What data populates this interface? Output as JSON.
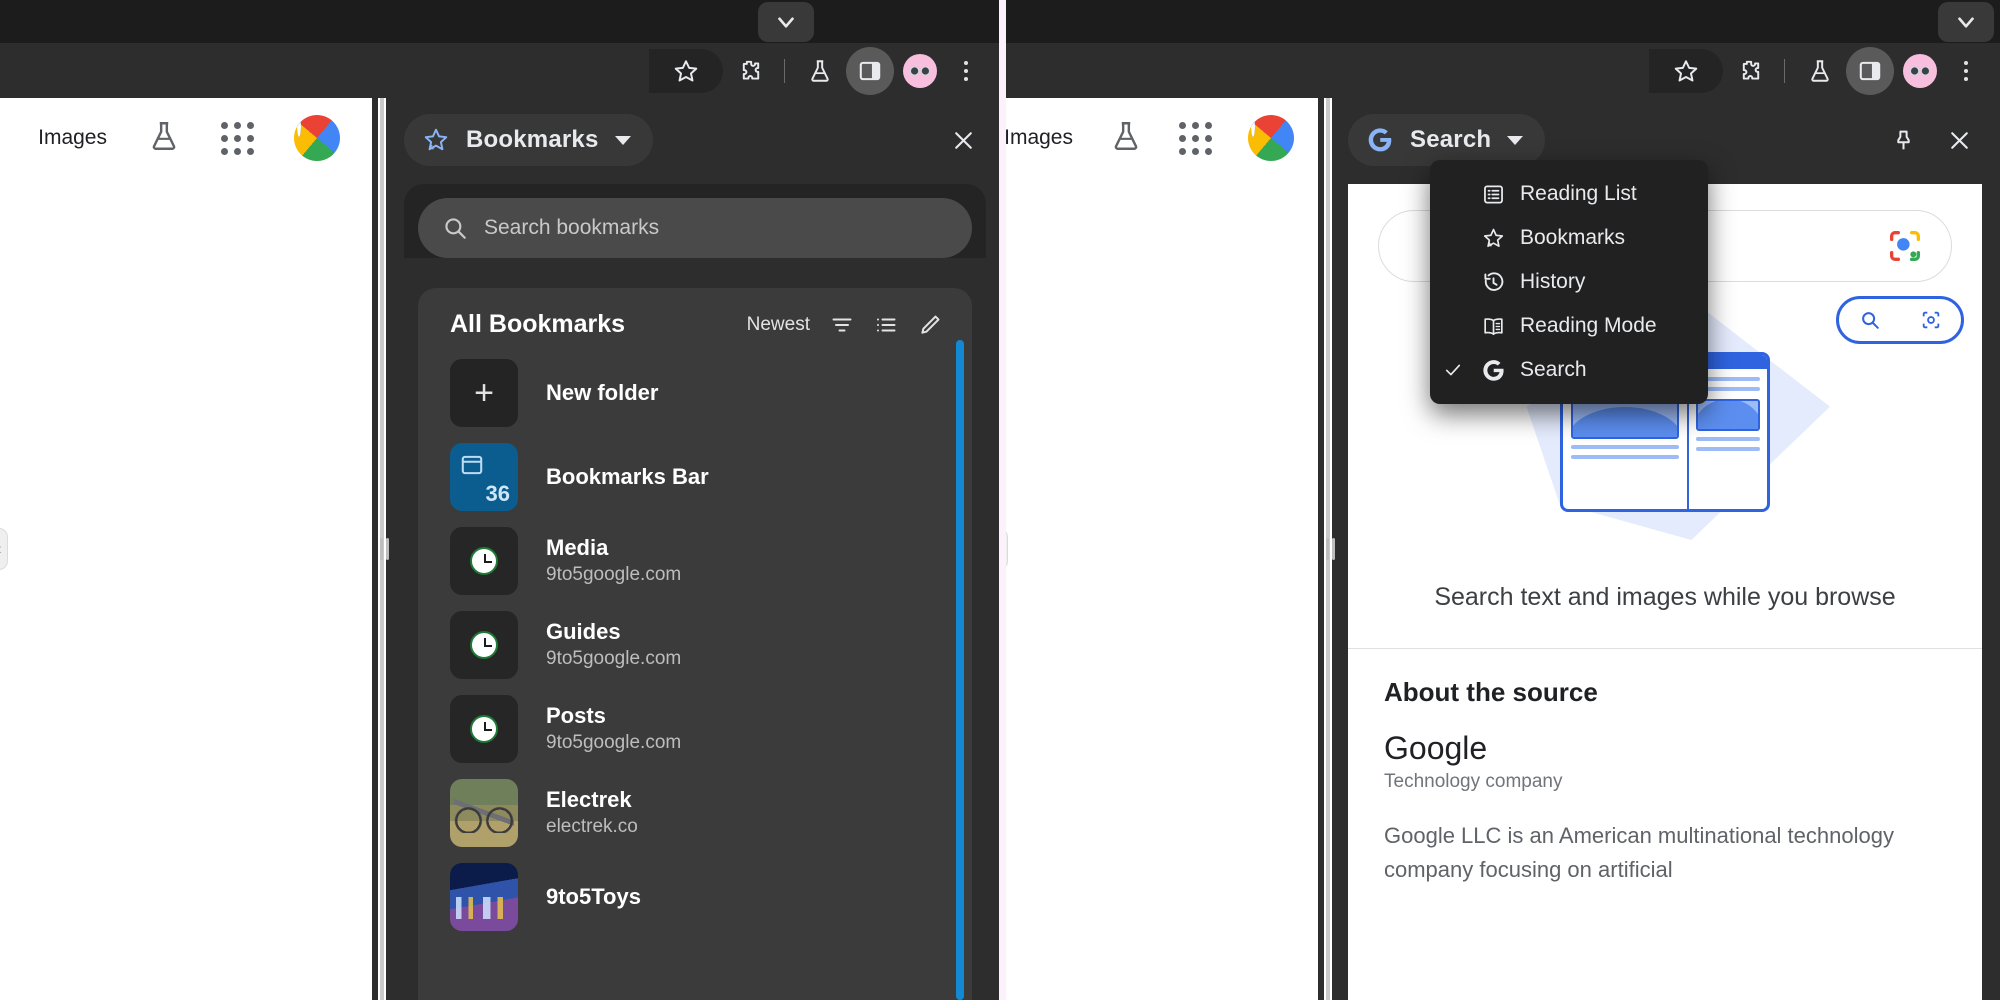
{
  "left_window": {
    "tab_chevron_icon": "chevron-down-icon",
    "toolbar": {
      "icons": [
        "bookmark-star-icon",
        "extensions-puzzle-icon",
        "labs-flask-icon",
        "side-panel-icon",
        "profile-avatar-icon",
        "more-vertical-icon"
      ]
    },
    "page": {
      "images_label": "Images",
      "labs_icon": "labs-flask-icon",
      "apps_icon": "apps-grid-icon",
      "account_icon": "google-account-avatar"
    },
    "side_panel": {
      "combo_label": "Bookmarks",
      "combo_icon": "bookmark-star-icon",
      "caret_icon": "chevron-down-icon",
      "close_icon": "close-icon",
      "search": {
        "placeholder": "Search bookmarks",
        "value": "",
        "icon": "search-icon"
      },
      "list_title": "All Bookmarks",
      "sort_label": "Newest",
      "sort_icon": "sort-filter-icon",
      "view_icon": "list-view-icon",
      "edit_icon": "edit-pencil-icon",
      "new_folder_label": "New folder",
      "new_folder_icon": "plus-icon",
      "items": [
        {
          "title": "Bookmarks Bar",
          "subtitle": "",
          "kind": "folder",
          "count": "36"
        },
        {
          "title": "Media",
          "subtitle": "9to5google.com",
          "kind": "clock"
        },
        {
          "title": "Guides",
          "subtitle": "9to5google.com",
          "kind": "clock"
        },
        {
          "title": "Posts",
          "subtitle": "9to5google.com",
          "kind": "clock"
        },
        {
          "title": "Electrek",
          "subtitle": "electrek.co",
          "kind": "bike"
        },
        {
          "title": "9to5Toys",
          "subtitle": "",
          "kind": "toys"
        }
      ]
    }
  },
  "right_window": {
    "tab_chevron_icon": "chevron-down-icon",
    "page": {
      "images_label": "Images",
      "labs_icon": "labs-flask-icon",
      "apps_icon": "apps-grid-icon",
      "account_icon": "google-account-avatar"
    },
    "side_panel": {
      "combo_label": "Search",
      "combo_icon": "google-g-icon",
      "caret_icon": "chevron-down-icon",
      "pin_icon": "pin-icon",
      "close_icon": "close-icon",
      "menu": {
        "items": [
          {
            "label": "Reading List",
            "icon": "reading-list-icon",
            "checked": false
          },
          {
            "label": "Bookmarks",
            "icon": "bookmark-star-icon",
            "checked": false
          },
          {
            "label": "History",
            "icon": "history-icon",
            "checked": false
          },
          {
            "label": "Reading Mode",
            "icon": "reading-mode-icon",
            "checked": false
          },
          {
            "label": "Search",
            "icon": "google-g-icon",
            "checked": true
          }
        ]
      },
      "lens": {
        "search_lens_icon": "google-lens-icon",
        "caption": "Search text and images while you browse",
        "about_heading": "About the source",
        "source_name": "Google",
        "source_type": "Technology company",
        "source_description": "Google LLC is an American multinational technology company focusing on artificial"
      }
    }
  },
  "colors": {
    "toolbar_bg": "#2d2d2d",
    "panel_bg": "#3b3b3b",
    "menu_bg": "#212121",
    "accent_blue": "#1389d4",
    "folder_blue": "#0b5c8f",
    "divider_pink": "#fdf2fb"
  }
}
